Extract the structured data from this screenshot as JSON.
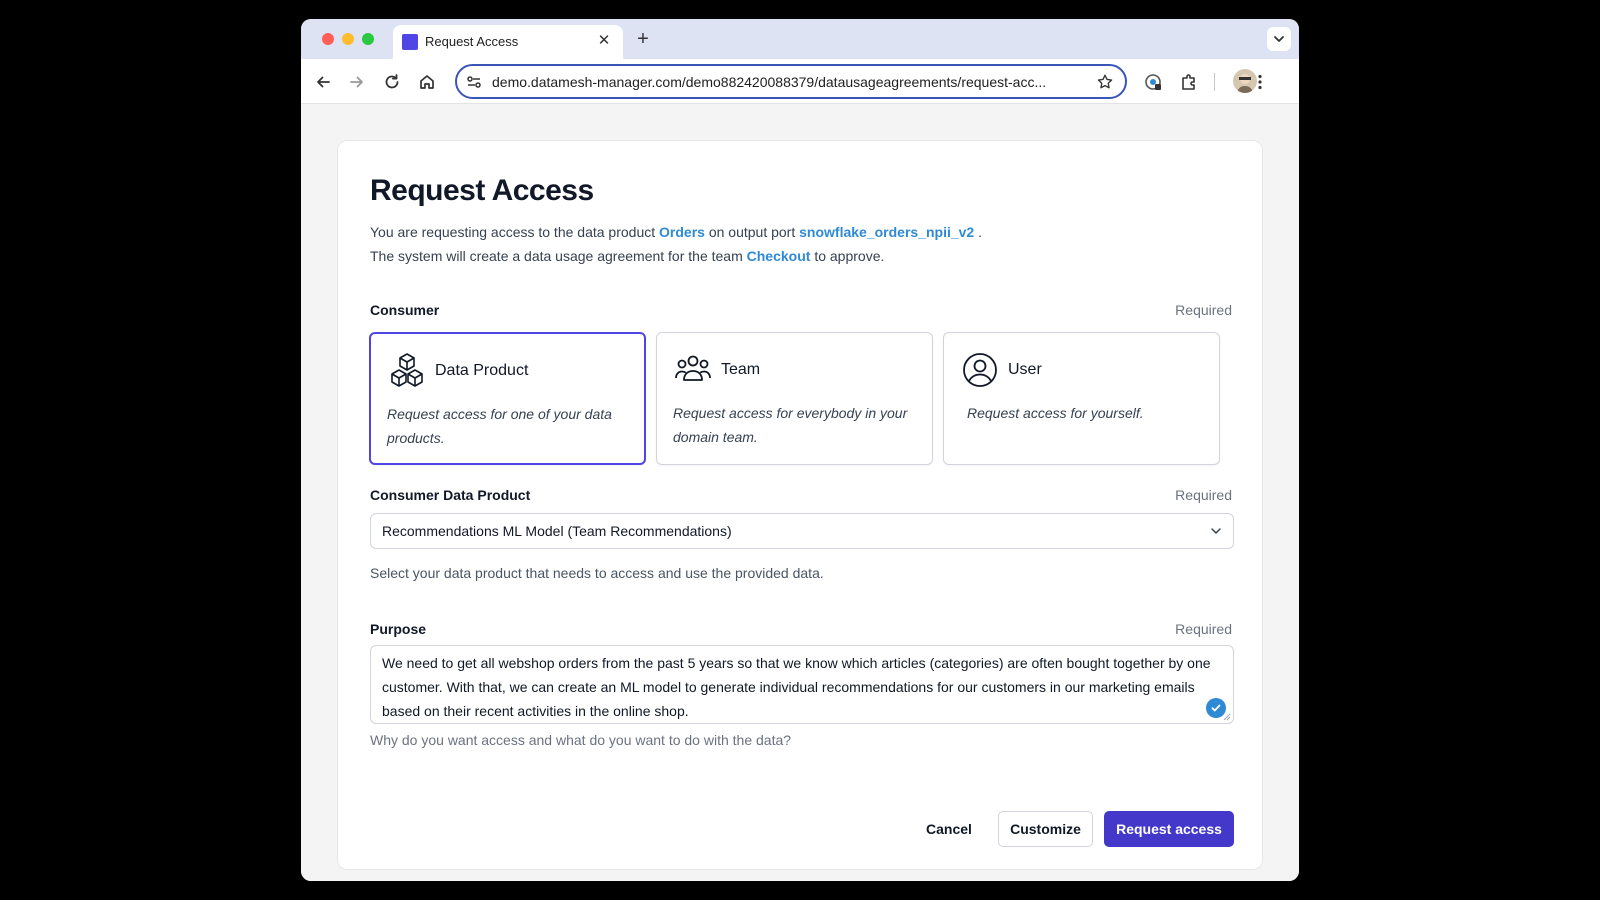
{
  "browser": {
    "tab_title": "Request Access",
    "url": "demo.datamesh-manager.com/demo882420088379/datausageagreements/request-acc..."
  },
  "page": {
    "title": "Request Access",
    "intro1": {
      "prefix": "You are requesting access to the data product",
      "product": "Orders",
      "middle": "on output port",
      "port": "snowflake_orders_npii_v2",
      "suffix": "."
    },
    "intro2": {
      "prefix": "The system will create a data usage agreement for the team",
      "team": "Checkout",
      "suffix": "to approve."
    }
  },
  "consumer": {
    "label": "Consumer",
    "required": "Required",
    "options": [
      {
        "title": "Data Product",
        "description": "Request access for one of your data products.",
        "icon": "cubes-icon",
        "selected": true
      },
      {
        "title": "Team",
        "description": "Request access for everybody in your domain team.",
        "icon": "user-group-icon",
        "selected": false
      },
      {
        "title": "User",
        "description": "Request access for yourself.",
        "icon": "user-circle-icon",
        "selected": false
      }
    ]
  },
  "consumer_data_product": {
    "label": "Consumer Data Product",
    "required": "Required",
    "value": "Recommendations ML Model (Team Recommendations)",
    "help": "Select your data product that needs to access and use the provided data."
  },
  "purpose": {
    "label": "Purpose",
    "required": "Required",
    "value": "We need to get all webshop orders from the past 5 years so that we know which articles (categories) are often bought together by one customer. With that, we can create an ML model to generate individual recommendations for our customers in our marketing emails based on their recent activities in the online shop.",
    "help": "Why do you want access and what do you want to do with the data?"
  },
  "actions": {
    "cancel": "Cancel",
    "customize": "Customize",
    "request": "Request access"
  },
  "colors": {
    "accent": "#4f46e5",
    "link": "#2f8ad6",
    "primary_button": "#4338ca"
  }
}
